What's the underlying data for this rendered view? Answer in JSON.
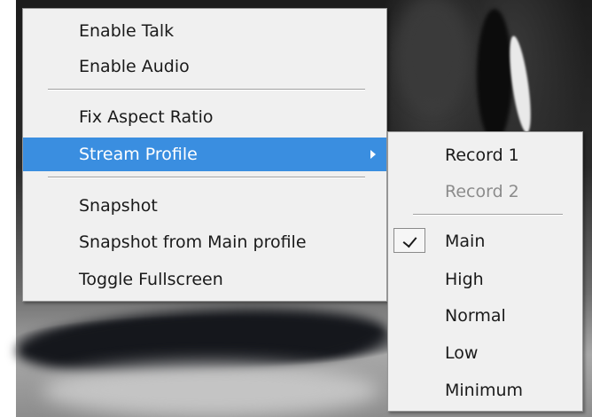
{
  "context_menu": {
    "items": [
      {
        "label": "Enable Talk"
      },
      {
        "label": "Enable Audio"
      },
      {
        "label": "Fix Aspect Ratio"
      },
      {
        "label": "Stream Profile",
        "highlighted": true,
        "has_submenu": true
      },
      {
        "label": "Snapshot"
      },
      {
        "label": "Snapshot from Main profile"
      },
      {
        "label": "Toggle Fullscreen"
      }
    ],
    "highlight_color": "#3a8ee0"
  },
  "stream_profile_submenu": {
    "items": [
      {
        "label": "Record 1",
        "enabled": true
      },
      {
        "label": "Record 2",
        "enabled": false
      },
      {
        "label": "Main",
        "checked": true
      },
      {
        "label": "High"
      },
      {
        "label": "Normal"
      },
      {
        "label": "Low"
      },
      {
        "label": "Minimum"
      }
    ],
    "icons": {
      "check": "checkmark-icon",
      "submenu_arrow": "chevron-right-icon"
    }
  }
}
